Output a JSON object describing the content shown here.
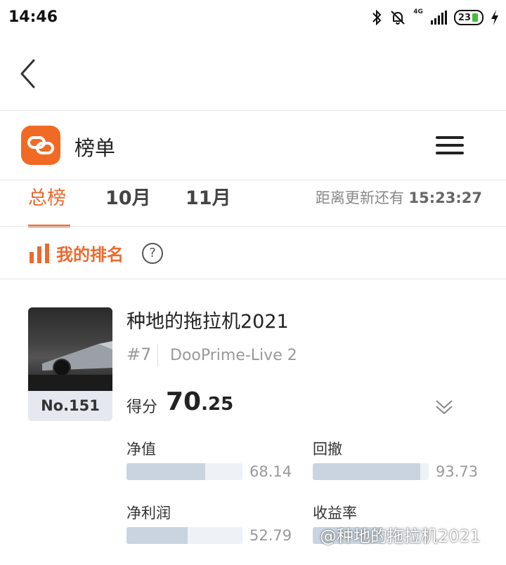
{
  "status_bar": {
    "time": "14:46",
    "network": "4G",
    "battery": "23"
  },
  "header": {
    "app_title": "榜单"
  },
  "tabs": [
    {
      "label": "总榜",
      "active": true
    },
    {
      "label": "10月",
      "active": false
    },
    {
      "label": "11月",
      "active": false
    }
  ],
  "countdown": {
    "label": "距离更新还有",
    "time": "15:23:27"
  },
  "my_ranking": {
    "title": "我的排名"
  },
  "card": {
    "rank_no": "No.151",
    "username": "种地的拖拉机2021",
    "rank_hash": "#7",
    "server": "DooPrime-Live 2",
    "score_label": "得分",
    "score_int": "70",
    "score_dec": ".25",
    "metrics": [
      {
        "label": "净值",
        "value": "68.14",
        "fill": 0.68
      },
      {
        "label": "回撤",
        "value": "93.73",
        "fill": 0.93
      },
      {
        "label": "净利润",
        "value": "52.79",
        "fill": 0.53
      },
      {
        "label": "收益率",
        "value": "",
        "fill": 0.6
      }
    ]
  },
  "watermark": "@种地的拖拉机2021",
  "colors": {
    "accent": "#ec6a2f",
    "logo_bg": "#f06a25",
    "bar_fill": "#c9d4df",
    "bar_track": "#eef2f7"
  }
}
